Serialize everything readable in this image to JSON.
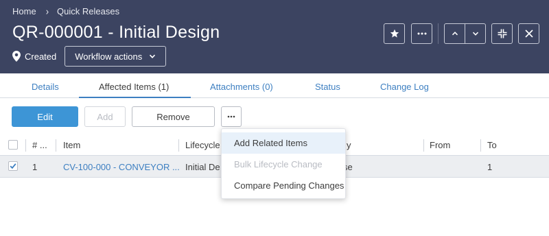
{
  "breadcrumb": {
    "home": "Home",
    "current": "Quick Releases"
  },
  "record": {
    "title": "QR-000001 - Initial Design",
    "status": "Created",
    "workflow_label": "Workflow actions"
  },
  "header_actions": {
    "favorite_icon": "star-icon",
    "more_icon": "ellipsis-icon",
    "prev_icon": "chevron-up-icon",
    "next_icon": "chevron-down-icon",
    "collapse_icon": "collapse-icon",
    "close_icon": "close-icon"
  },
  "tabs": [
    {
      "label": "Details",
      "active": false
    },
    {
      "label": "Affected Items (1)",
      "active": true
    },
    {
      "label": "Attachments (0)",
      "active": false
    },
    {
      "label": "Status",
      "active": false
    },
    {
      "label": "Change Log",
      "active": false
    }
  ],
  "toolbar": {
    "edit_label": "Edit",
    "add_label": "Add",
    "remove_label": "Remove",
    "more_label": "•••"
  },
  "table": {
    "columns": [
      "# ...",
      "Item",
      "Lifecycle",
      "y",
      "From",
      "To"
    ],
    "rows": [
      {
        "selected": true,
        "number": "1",
        "item": "CV-100-000 - CONVEYOR ...",
        "lifecycle": "Initial De",
        "partial": "se",
        "from": "",
        "to": "1"
      }
    ]
  },
  "menu": {
    "items": [
      {
        "label": "Add Related Items",
        "state": "hover"
      },
      {
        "label": "Bulk Lifecycle Change",
        "state": "disabled"
      },
      {
        "label": "Compare Pending Changes",
        "state": "normal"
      }
    ]
  },
  "colors": {
    "header_bg": "#3c4461",
    "accent": "#3d95d6",
    "link": "#3d7fc1",
    "row_selected": "#eceef1"
  }
}
